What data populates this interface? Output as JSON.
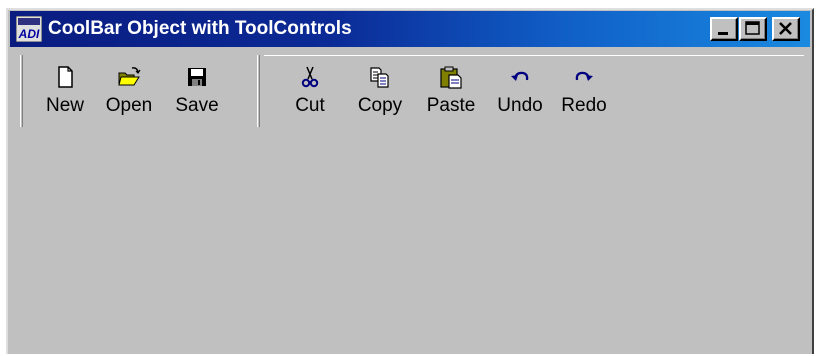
{
  "window": {
    "title": "CoolBar Object with ToolControls",
    "app_icon": "app-icon"
  },
  "caption_buttons": {
    "minimize": "minimize-icon",
    "maximize": "maximize-icon",
    "close": "close-icon"
  },
  "coolbar": {
    "band1": [
      {
        "label": "New",
        "icon": "new-document-icon"
      },
      {
        "label": "Open",
        "icon": "open-folder-icon"
      },
      {
        "label": "Save",
        "icon": "save-disk-icon"
      }
    ],
    "band2": [
      {
        "label": "Cut",
        "icon": "scissors-icon"
      },
      {
        "label": "Copy",
        "icon": "copy-icon"
      },
      {
        "label": "Paste",
        "icon": "paste-clipboard-icon"
      },
      {
        "label": "Undo",
        "icon": "undo-arrow-icon"
      },
      {
        "label": "Redo",
        "icon": "redo-arrow-icon"
      }
    ]
  },
  "colors": {
    "titlebar_start": "#0a1c80",
    "titlebar_end": "#1a8ae0",
    "face": "#c0c0c0",
    "icon_blue": "#000080"
  }
}
